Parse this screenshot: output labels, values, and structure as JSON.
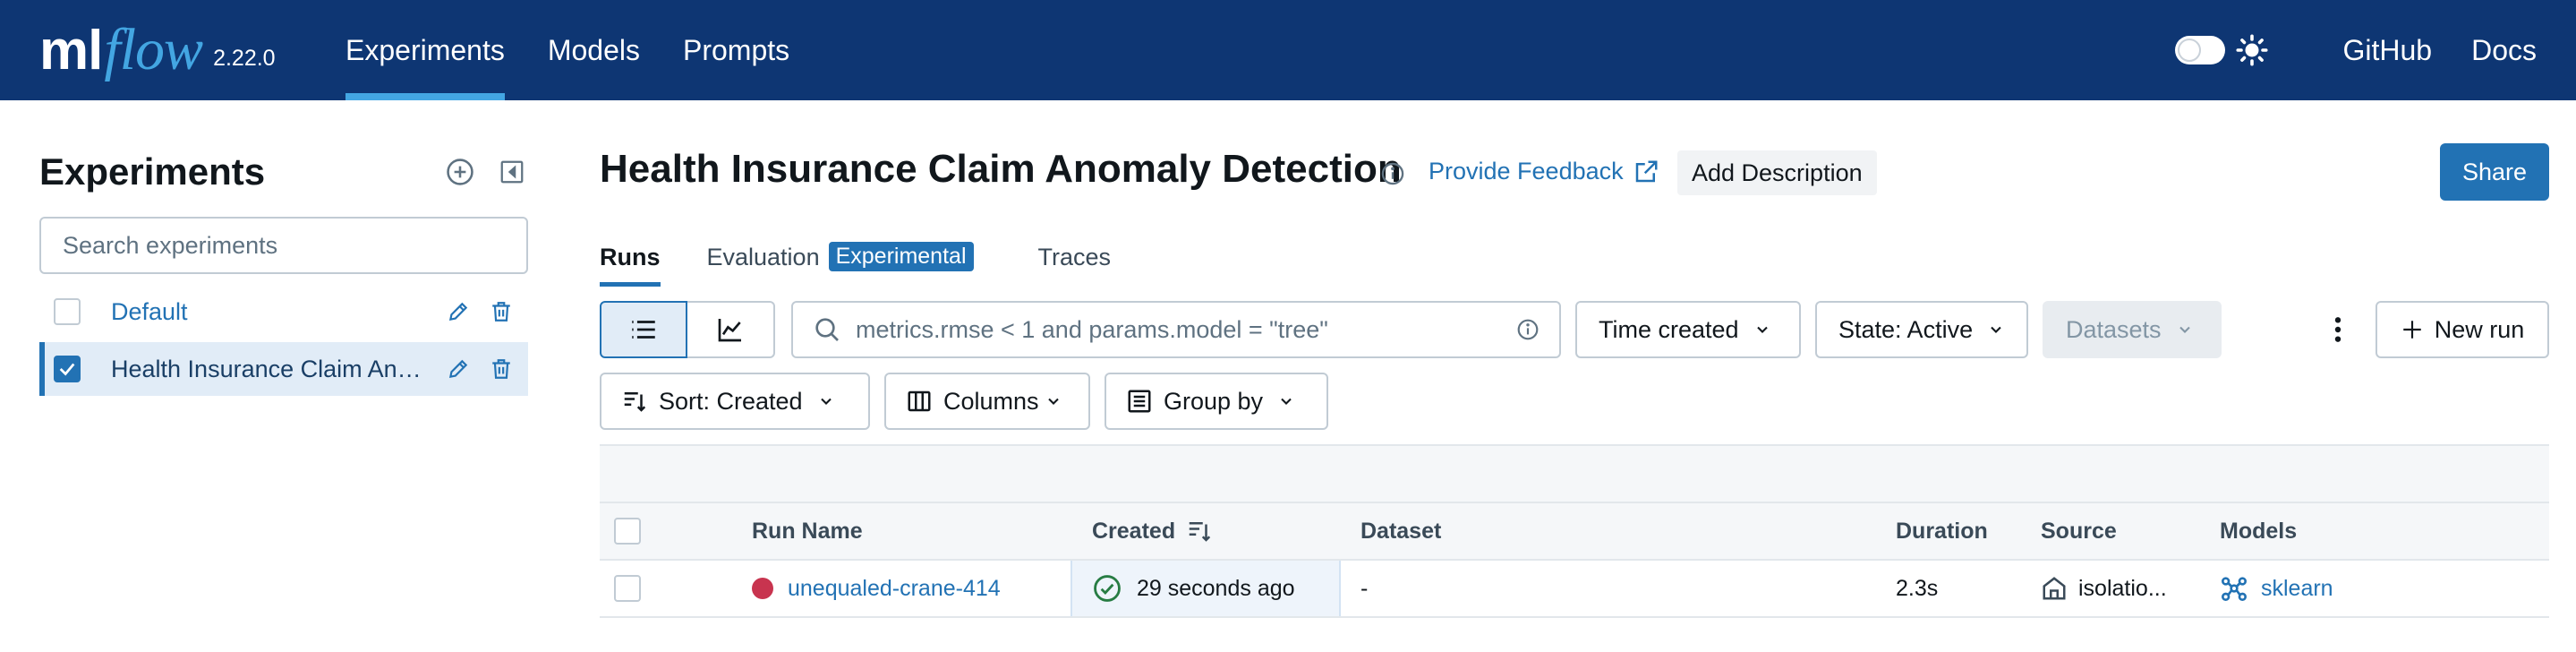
{
  "app": {
    "logo_ml": "ml",
    "logo_flow": "flow",
    "version": "2.22.0",
    "nav_tabs": [
      {
        "label": "Experiments",
        "active": true
      },
      {
        "label": "Models",
        "active": false
      },
      {
        "label": "Prompts",
        "active": false
      }
    ],
    "right_links": {
      "github": "GitHub",
      "docs": "Docs"
    },
    "theme_toggle": "sun-icon",
    "colors": {
      "navbar": "#0e3673",
      "accent": "#43a6e2",
      "primary": "#2272b4",
      "run_status": "#c8344f"
    }
  },
  "sidebar": {
    "title": "Experiments",
    "add_icon": "plus-circle-icon",
    "collapse_icon": "collapse-sidebar-icon",
    "search_placeholder": "Search experiments",
    "items": [
      {
        "label": "Default",
        "checked": false,
        "selected": false
      },
      {
        "label": "Health Insurance Claim Anomaly Detection",
        "checked": true,
        "selected": true
      }
    ]
  },
  "header": {
    "title": "Health Insurance Claim Anomaly Detection",
    "feedback": "Provide Feedback",
    "add_description": "Add Description",
    "share": "Share"
  },
  "subtabs": {
    "runs": "Runs",
    "evaluation": "Evaluation",
    "experimental_badge": "Experimental",
    "traces": "Traces"
  },
  "toolbar": {
    "search_placeholder": "metrics.rmse < 1 and params.model = \"tree\"",
    "time_created": "Time created",
    "state": "State: Active",
    "datasets": "Datasets",
    "new_run": "New run",
    "sort": "Sort: Created",
    "columns": "Columns",
    "group_by": "Group by"
  },
  "table": {
    "columns": [
      "Run Name",
      "Created",
      "Dataset",
      "Duration",
      "Source",
      "Models"
    ],
    "rows": [
      {
        "run_name": "unequaled-crane-414",
        "created": "29 seconds ago",
        "dataset": "-",
        "duration": "2.3s",
        "source": "isolatio...",
        "models": "sklearn"
      }
    ]
  }
}
